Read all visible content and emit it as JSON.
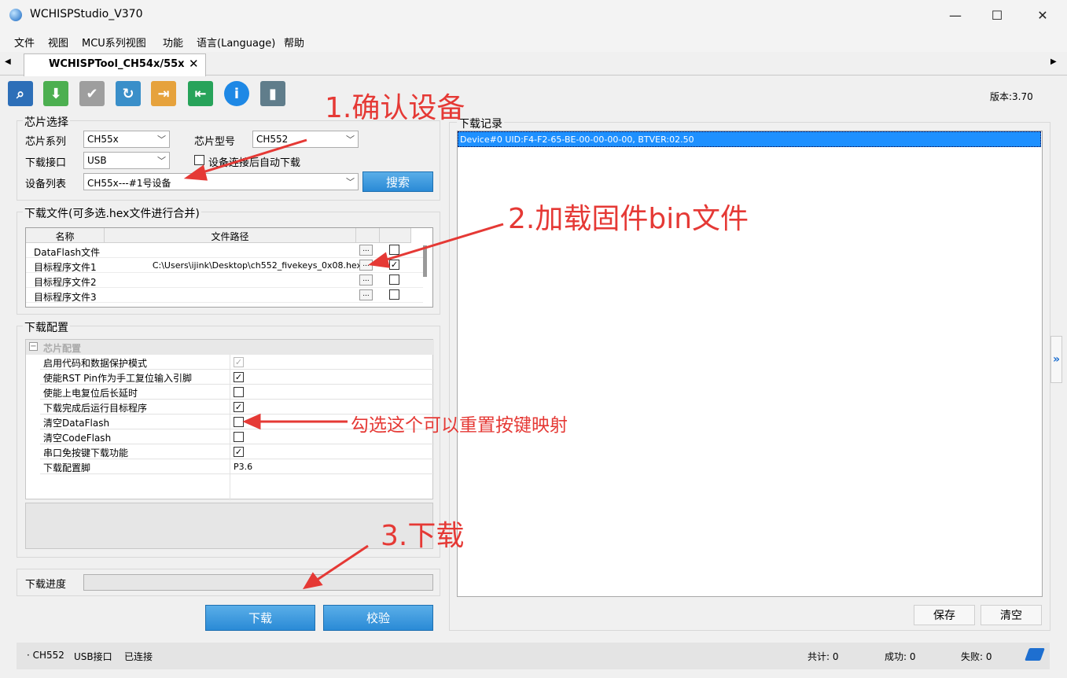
{
  "window": {
    "title": "WCHISPStudio_V370",
    "minimize": "—",
    "maximize": "☐",
    "close": "✕"
  },
  "menu": [
    "文件",
    "视图",
    "MCU系列视图",
    "功能",
    "语言(Language)",
    "帮助"
  ],
  "tab": {
    "label": "WCHISPTool_CH54x/55x",
    "close": "✕",
    "scroll_left": "◀",
    "scroll_right": "▶"
  },
  "toolbar": {
    "icons": [
      "search-icon",
      "download-icon",
      "verify-icon",
      "refresh-icon",
      "import-icon",
      "export-icon",
      "info-icon",
      "book-icon"
    ],
    "version": "版本:3.70"
  },
  "chip_select": {
    "title": "芯片选择",
    "series_label": "芯片系列",
    "series_value": "CH55x",
    "model_label": "芯片型号",
    "model_value": "CH552",
    "interface_label": "下载接口",
    "interface_value": "USB",
    "auto_download_label": "设备连接后自动下载",
    "device_list_label": "设备列表",
    "device_list_value": "CH55x---#1号设备",
    "search_button": "搜索"
  },
  "download_files": {
    "title": "下载文件(可多选.hex文件进行合并)",
    "headers": [
      "名称",
      "文件路径"
    ],
    "rows": [
      {
        "name": "DataFlash文件",
        "path": "",
        "checked": false
      },
      {
        "name": "目标程序文件1",
        "path": "C:\\Users\\ijink\\Desktop\\ch552_fivekeys_0x08.hex",
        "checked": true
      },
      {
        "name": "目标程序文件2",
        "path": "",
        "checked": false
      },
      {
        "name": "目标程序文件3",
        "path": "",
        "checked": false
      }
    ],
    "browse_label": "..."
  },
  "download_config": {
    "title": "下载配置",
    "section": "芯片配置",
    "rows": [
      {
        "name": "启用代码和数据保护模式",
        "value": "✓",
        "state": "disabled"
      },
      {
        "name": "使能RST Pin作为手工复位输入引脚",
        "value": "✓",
        "state": "checked"
      },
      {
        "name": "使能上电复位后长延时",
        "value": "",
        "state": "unchecked"
      },
      {
        "name": "下载完成后运行目标程序",
        "value": "✓",
        "state": "checked"
      },
      {
        "name": "清空DataFlash",
        "value": "",
        "state": "unchecked"
      },
      {
        "name": "清空CodeFlash",
        "value": "",
        "state": "unchecked"
      },
      {
        "name": "串口免按键下载功能",
        "value": "✓",
        "state": "checked"
      },
      {
        "name": "下载配置脚",
        "value": "P3.6",
        "state": "text"
      }
    ]
  },
  "progress": {
    "label": "下载进度",
    "value": 0
  },
  "actions": {
    "download": "下载",
    "verify": "校验"
  },
  "log": {
    "title": "下载记录",
    "entries": [
      "Device#0  UID:F4-F2-65-BE-00-00-00-00, BTVER:02.50"
    ],
    "save": "保存",
    "clear": "清空",
    "expand": "»"
  },
  "status": {
    "chip": "· CH552",
    "interface": "USB接口",
    "connection": "已连接",
    "total": "共计:  0",
    "success": "成功:  0",
    "fail": "失败:  0"
  },
  "annotations": {
    "step1": "1.确认设备",
    "step2": "2.加载固件bin文件",
    "step3": "3.下载",
    "note": "勾选这个可以重置按键映射"
  },
  "colors": {
    "accent": "#2a8ad6",
    "selection": "#1e90ff",
    "annotation": "#e53935"
  }
}
